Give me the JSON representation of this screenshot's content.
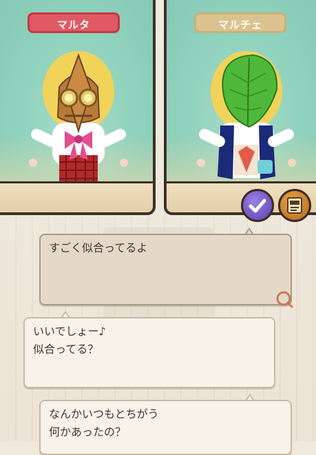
{
  "characters": {
    "left_name": "マルタ",
    "right_name": "マルチェ"
  },
  "buttons": {
    "confirm_icon": "check-icon",
    "camera_icon": "camera-icon"
  },
  "dialog": [
    {
      "lines": [
        "すごく似合ってるよ"
      ],
      "kind": "choice"
    },
    {
      "lines": [
        "いいでしょー♪",
        "似合ってる？"
      ],
      "kind": "npc"
    },
    {
      "lines": [
        "なんかいつもとちがう",
        "何かあったの？"
      ],
      "kind": "npc"
    }
  ],
  "colors": {
    "active_tag": "#e05a64",
    "inactive_tag": "#dcc28e",
    "panel_bg": "#8fd2bd",
    "confirm_button": "#6b4cc4",
    "camera_button": "#c98226"
  }
}
